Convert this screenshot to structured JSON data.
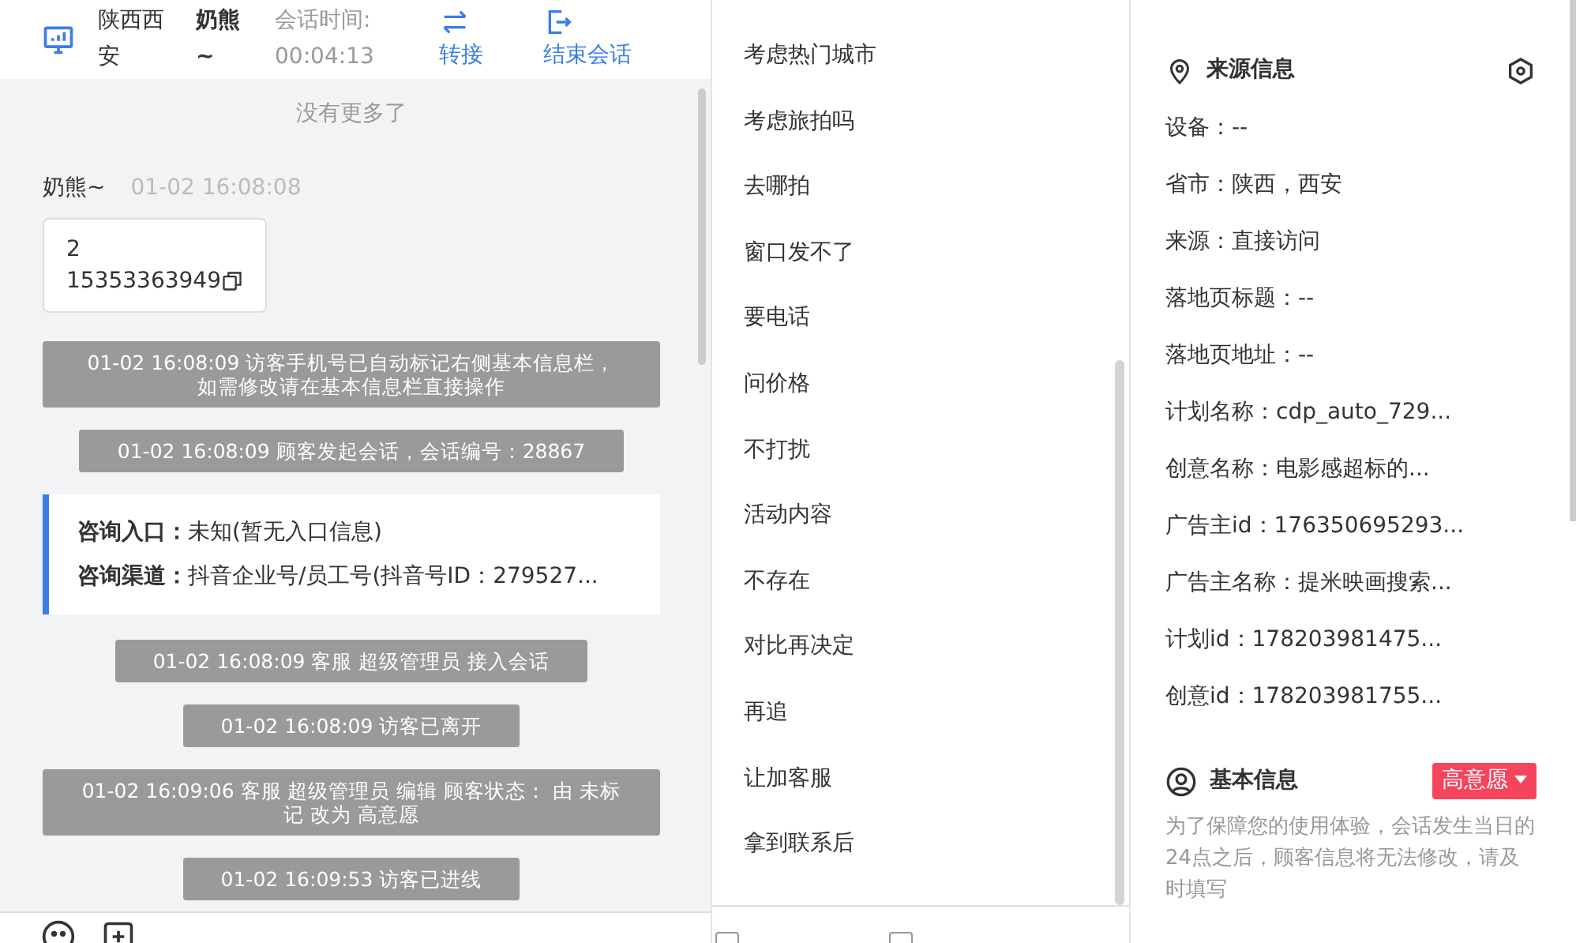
{
  "header": {
    "location": "陕西西安",
    "visitor": "奶熊~",
    "timer_label": "会话时间:",
    "timer": "00:04:13",
    "actions": [
      {
        "kind": "transfer",
        "label": "转接"
      },
      {
        "kind": "end",
        "label": "结束会话"
      }
    ]
  },
  "chat": {
    "no_more": "没有更多了",
    "messages": [
      {
        "kind": "visitor",
        "sender": "奶熊~",
        "time": "01-02 16:08:08",
        "lines": [
          "2",
          "15353363949"
        ]
      },
      {
        "kind": "system",
        "text": "01-02 16:08:09 访客手机号已自动标记右侧基本信息栏，如需修改请在基本信息栏直接操作"
      },
      {
        "kind": "system",
        "text": "01-02 16:08:09 顾客发起会话，会话编号：28867"
      },
      {
        "kind": "info",
        "rows": [
          {
            "label": "咨询入口：",
            "value": "未知(暂无入口信息)"
          },
          {
            "label": "咨询渠道：",
            "value": "抖音企业号/员工号(抖音号ID：279527..."
          }
        ]
      },
      {
        "kind": "system",
        "text": "01-02 16:08:09 客服 超级管理员 接入会话"
      },
      {
        "kind": "system",
        "text": "01-02 16:08:09 访客已离开"
      },
      {
        "kind": "system",
        "text": "01-02 16:09:06 客服 超级管理员 编辑 顾客状态： 由 未标记 改为 高意愿"
      },
      {
        "kind": "system",
        "text": "01-02 16:09:53 访客已进线"
      }
    ]
  },
  "footer_checkboxes": [
    {
      "checked": false
    },
    {
      "checked": false
    }
  ],
  "quick_replies": [
    "考虑热门城市",
    "考虑旅拍吗",
    "去哪拍",
    "窗口发不了",
    "要电话",
    "问价格",
    "不打扰",
    "活动内容",
    "不存在",
    "对比再决定",
    "再追",
    "让加客服",
    "拿到联系后"
  ],
  "source_info": {
    "title": "来源信息",
    "fields": [
      "设备：--",
      "省市：陕西，西安",
      "来源：直接访问",
      "落地页标题：--",
      "落地页地址：--",
      "计划名称：cdp_auto_729...",
      "创意名称：电影感超标的...",
      "广告主id：176350695293...",
      "广告主名称：提米映画搜索...",
      "计划id：178203981475...",
      "创意id：178203981755..."
    ]
  },
  "basic_info": {
    "title": "基本信息",
    "status": "高意愿",
    "notice": "为了保障您的使用体验，会话发生当日的24点之后，顾客信息将无法修改，请及时填写"
  }
}
